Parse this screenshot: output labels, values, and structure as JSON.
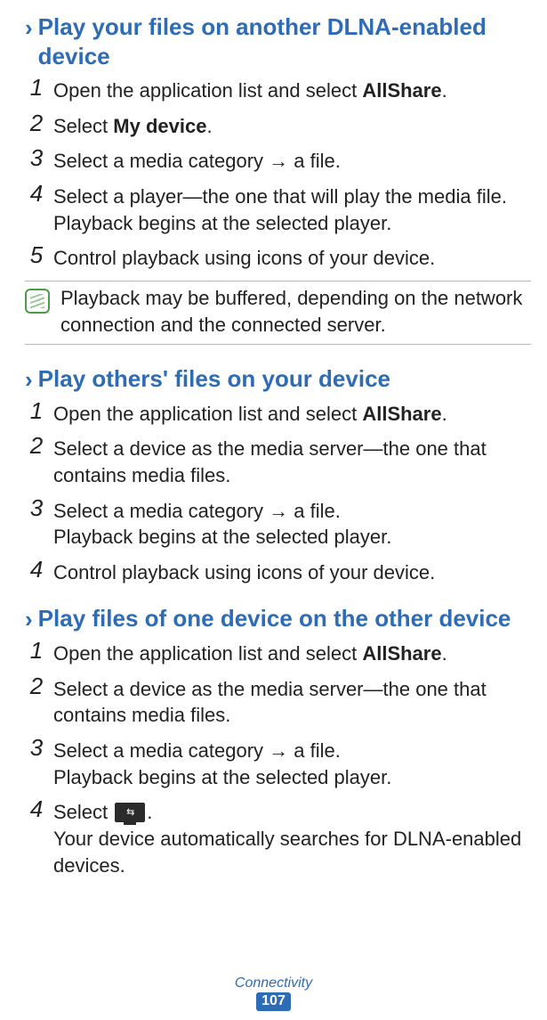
{
  "headings": {
    "h1": "Play your files on another DLNA-enabled device",
    "h2": "Play others' files on your device",
    "h3": "Play files of one device on the other device"
  },
  "bold": {
    "allshare": "AllShare",
    "mydevice": "My device"
  },
  "sec1": {
    "s1a": "Open the application list and select ",
    "s1b": ".",
    "s2a": "Select ",
    "s2b": ".",
    "s3": "Select a media category → a file.",
    "s4": "Select a player—the one that will play the media file. Playback begins at the selected player.",
    "s5": "Control playback using icons of your device."
  },
  "note": "Playback may be buffered, depending on the network connection and the connected server.",
  "sec2": {
    "s1a": "Open the application list and select ",
    "s1b": ".",
    "s2": "Select a device as the media server—the one that contains media files.",
    "s3a": "Select a media category → a file.",
    "s3b": "Playback begins at the selected player.",
    "s4": "Control playback using icons of your device."
  },
  "sec3": {
    "s1a": "Open the application list and select ",
    "s1b": ".",
    "s2": "Select a device as the media server—the one that contains media files.",
    "s3a": "Select a media category → a file.",
    "s3b": "Playback begins at the selected player.",
    "s4a": "Select ",
    "s4b": ".",
    "s4c": "Your device automatically searches for DLNA-enabled devices."
  },
  "footer": {
    "chapter": "Connectivity",
    "page": "107"
  }
}
